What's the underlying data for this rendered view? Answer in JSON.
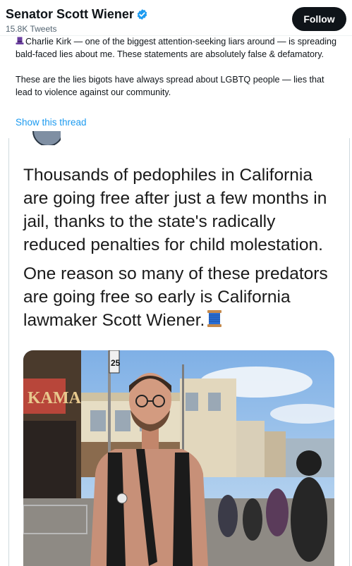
{
  "header": {
    "name": "Senator Scott Wiener",
    "tweet_count": "15.8K Tweets",
    "follow_label": "Follow"
  },
  "tweet": {
    "paragraph1": "Charlie Kirk — one of the biggest attention-seeking liars around — is spreading bald-faced lies about me. These statements are absolutely false & defamatory.",
    "paragraph2": "These are the lies bigots have always spread about LGBTQ people — lies that lead to violence against our community.",
    "show_thread": "Show this thread"
  },
  "quote": {
    "paragraph1": "Thousands of pedophiles in California are going free after just a few months in jail, thanks to the state's radically reduced penalties for child molestation.",
    "paragraph2": "One reason so many of these predators are going free so early is California lawmaker Scott Wiener."
  },
  "photo": {
    "sign_text": "KAMA",
    "street_sign": "25"
  },
  "colors": {
    "link": "#1d9bf0",
    "verified": "#1d9bf0",
    "follow_bg": "#0f1419",
    "secondary_text": "#536471"
  }
}
